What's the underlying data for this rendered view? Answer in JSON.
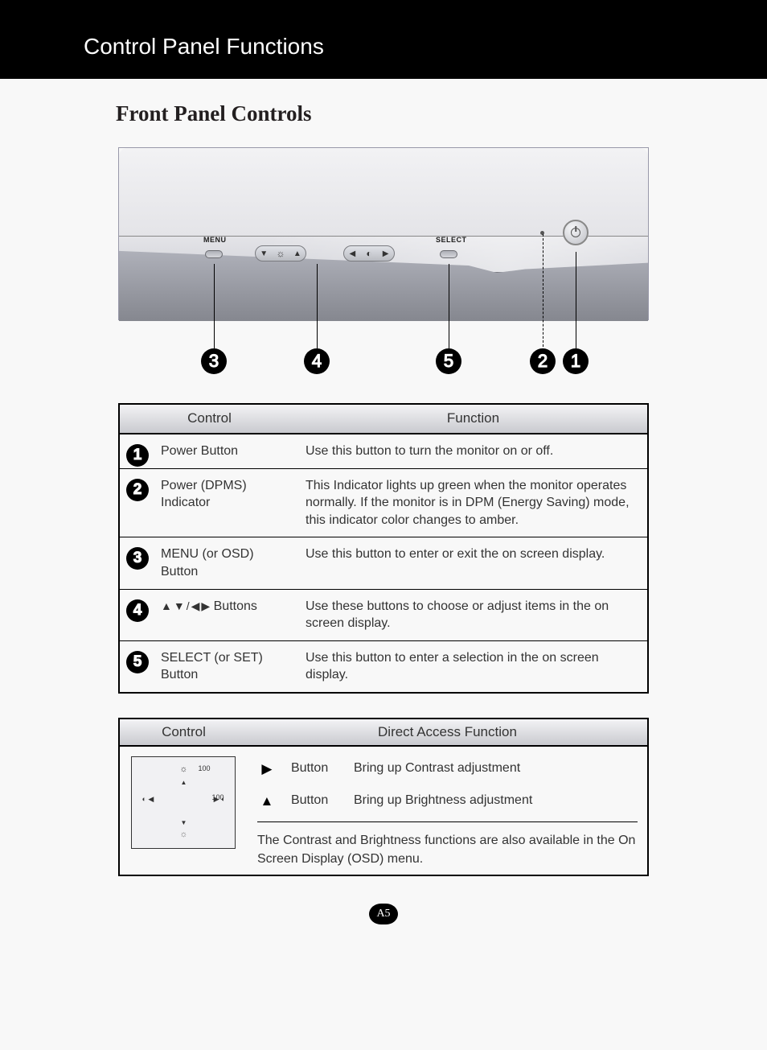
{
  "header": {
    "title": "Control Panel Functions"
  },
  "section": {
    "title": "Front Panel Controls"
  },
  "panel_labels": {
    "menu": "MENU",
    "select": "SELECT"
  },
  "callouts": {
    "c3": "3",
    "c4": "4",
    "c5": "5",
    "c2": "2",
    "c1": "1"
  },
  "table1": {
    "head1": "Control",
    "head2": "Function",
    "rows": [
      {
        "n": "1",
        "ctrl": "Power Button",
        "func": "Use this button to turn the monitor on or off."
      },
      {
        "n": "2",
        "ctrl": "Power (DPMS) Indicator",
        "func": "This Indicator lights up green when the monitor operates normally. If the monitor is in DPM (Energy Saving) mode, this indicator color changes to amber."
      },
      {
        "n": "3",
        "ctrl": "MENU (or OSD) Button",
        "func": "Use this button to enter or exit the on screen display."
      },
      {
        "n": "4",
        "ctrl_suffix": " Buttons",
        "func": "Use these buttons to choose or adjust items in the on screen display."
      },
      {
        "n": "5",
        "ctrl": "SELECT (or SET) Button",
        "func": "Use this button to enter a selection in the on screen display."
      }
    ]
  },
  "table2": {
    "head1": "Control",
    "head2": "Direct Access Function",
    "osd_val1": "100",
    "osd_val2": "100",
    "btn_label": "Button",
    "r1": "Bring up Contrast adjustment",
    "r2": "Bring up Brightness adjustment",
    "note": "The Contrast and Brightness functions are also available in the On Screen Display (OSD) menu."
  },
  "page": "A5"
}
